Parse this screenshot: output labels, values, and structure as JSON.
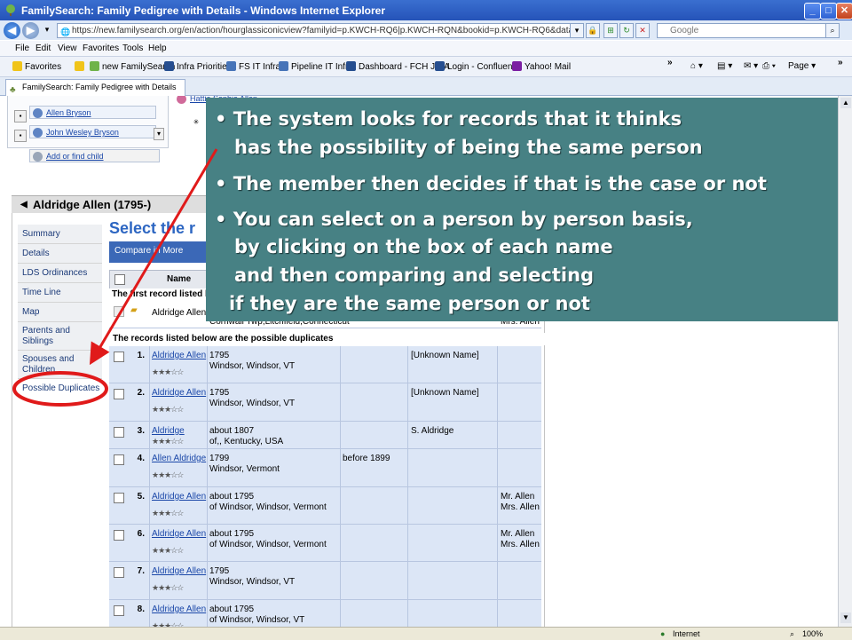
{
  "window": {
    "title": "FamilySearch: Family Pedigree with Details - Windows Internet Explorer"
  },
  "address": {
    "url": "https://new.familysearch.org/en/action/hourglassiconicview?familyid=p.KWCH-RQ6|p.KWCH-RQN&bookid=p.KWCH-RQ6&datapath=hq.p.KWCH-RQ6_p.KWCH",
    "search_placeholder": "Google"
  },
  "menu": [
    "File",
    "Edit",
    "View",
    "Favorites",
    "Tools",
    "Help"
  ],
  "favorites": {
    "label": "Favorites",
    "items": [
      "new FamilySearch",
      "Infra Priorities",
      "FS IT Infra",
      "Pipeline IT Infra",
      "Dashboard - FCH JIRA",
      "Login - Confluence",
      "Yahoo! Mail"
    ],
    "page_label": "Page"
  },
  "tab": {
    "label": "FamilySearch: Family Pedigree with Details"
  },
  "relatives": {
    "partial": "Hattie Sophia Allen",
    "items": [
      "Allen Bryson",
      "John Wesley Bryson"
    ],
    "add_child": "Add or find child"
  },
  "person": {
    "header": "Aldridge Allen (1795-)"
  },
  "sidenav": [
    "Summary",
    "Details",
    "LDS Ordinances",
    "Time Line",
    "Map",
    "Parents and Siblings",
    "Spouses and Children",
    "Possible Duplicates"
  ],
  "main": {
    "heading": "Select the r",
    "compare_button": "Compare in More Detail",
    "name_col": "Name",
    "first_record_caption": "The first record listed b",
    "first_record": {
      "name": "Aldridge Allen",
      "place": "Cornwall Twp,Litchfield,Connecticut",
      "parents": "Mrs. Allen"
    },
    "dup_caption": "The records listed below are the possible duplicates",
    "rows": [
      {
        "num": "1.",
        "name": "Aldridge Allen",
        "stars": "★★★☆☆",
        "date": "1795",
        "place": "Windsor, Windsor, VT",
        "date2": "",
        "spouse": "[Unknown Name]",
        "p1": "",
        "p2": ""
      },
      {
        "num": "2.",
        "name": "Aldridge Allen",
        "stars": "★★★☆☆",
        "date": "1795",
        "place": "Windsor, Windsor, VT",
        "date2": "",
        "spouse": "[Unknown Name]",
        "p1": "",
        "p2": ""
      },
      {
        "num": "3.",
        "name": "Aldridge",
        "stars": "★★★☆☆",
        "date": "about 1807",
        "place": "of,, Kentucky, USA",
        "date2": "",
        "spouse": "S. Aldridge",
        "p1": "",
        "p2": ""
      },
      {
        "num": "4.",
        "name": "Allen Aldridge",
        "stars": "★★★☆☆",
        "date": "1799",
        "place": "Windsor, Vermont",
        "date2": "before 1899",
        "spouse": "",
        "p1": "",
        "p2": ""
      },
      {
        "num": "5.",
        "name": "Aldridge Allen",
        "stars": "★★★☆☆",
        "date": "about 1795",
        "place": "of Windsor, Windsor, Vermont",
        "date2": "",
        "spouse": "",
        "p1": "Mr. Allen",
        "p2": "Mrs. Allen"
      },
      {
        "num": "6.",
        "name": "Aldridge Allen",
        "stars": "★★★☆☆",
        "date": "about 1795",
        "place": "of Windsor, Windsor, Vermont",
        "date2": "",
        "spouse": "",
        "p1": "Mr. Allen",
        "p2": "Mrs. Allen"
      },
      {
        "num": "7.",
        "name": "Aldridge Allen",
        "stars": "★★★☆☆",
        "date": "1795",
        "place": "Windsor, Windsor, VT",
        "date2": "",
        "spouse": "",
        "p1": "",
        "p2": ""
      },
      {
        "num": "8.",
        "name": "Aldridge Allen",
        "stars": "★★★☆☆",
        "date": "about 1795",
        "place": "of Windsor, Windsor, VT",
        "date2": "",
        "spouse": "",
        "p1": "",
        "p2": ""
      }
    ]
  },
  "overlay": {
    "b1a": "• The system looks for records that it thinks",
    "b1b": "has the possibility of being the same person",
    "b2": "• The member then decides if that is the case or not",
    "b3a": "• You can select on a person by person basis,",
    "b3b": "by clicking on the box of each name",
    "b3c": "and then comparing and selecting",
    "b3d": "if they are the same person or not"
  },
  "status": {
    "zone": "Internet",
    "zoom": "100%"
  },
  "colors": {
    "overlay_bg": "#478184",
    "annotation_red": "#e01a1a",
    "title_blue": "#2553b8"
  }
}
